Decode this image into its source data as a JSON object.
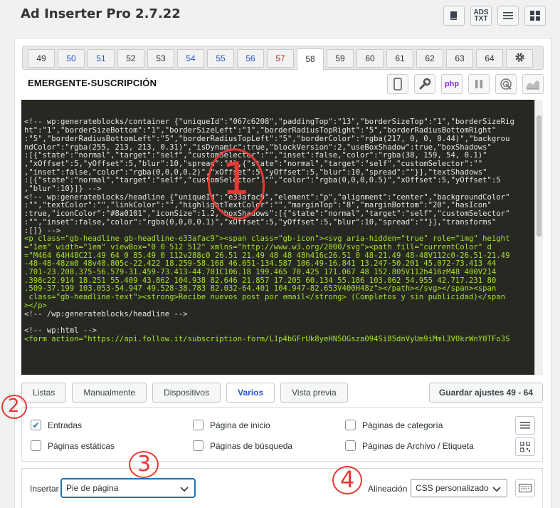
{
  "app": {
    "title": "Ad Inserter Pro 2.7.22",
    "top_icons": [
      "book-icon",
      "ads-txt-icon",
      "list-icon",
      "grid-icon"
    ],
    "ads_txt_line1": "ADS",
    "ads_txt_line2": "TXT"
  },
  "tabs": {
    "items": [
      {
        "label": "49",
        "style": "normal"
      },
      {
        "label": "50",
        "style": "blue"
      },
      {
        "label": "51",
        "style": "blue"
      },
      {
        "label": "52",
        "style": "normal"
      },
      {
        "label": "53",
        "style": "normal"
      },
      {
        "label": "54",
        "style": "blue"
      },
      {
        "label": "55",
        "style": "blue"
      },
      {
        "label": "56",
        "style": "blue"
      },
      {
        "label": "57",
        "style": "red"
      },
      {
        "label": "58",
        "style": "active"
      },
      {
        "label": "59",
        "style": "normal"
      },
      {
        "label": "60",
        "style": "normal"
      },
      {
        "label": "61",
        "style": "normal"
      },
      {
        "label": "62",
        "style": "normal"
      },
      {
        "label": "63",
        "style": "normal"
      },
      {
        "label": "64",
        "style": "normal"
      }
    ],
    "settings_icon": "gear-icon"
  },
  "block": {
    "name": "EMERGENTE-SUSCRIPCIÓN",
    "tool_icons": [
      "device-icon",
      "wrench-icon",
      "php-icon",
      "pause-icon",
      "target-icon",
      "chart-icon"
    ],
    "php_label": "php"
  },
  "code": {
    "lines": [
      "<!-- wp:generateblocks/container {\"uniqueId\":\"067c6208\",\"paddingTop\":\"13\",\"borderSizeTop\":\"1\",\"borderSizeRig",
      "ht\":\"1\",\"borderSizeBottom\":\"1\",\"borderSizeLeft\":\"1\",\"borderRadiusTopRight\":\"5\",\"borderRadiusBottomRight\"",
      ":\"5\",\"borderRadiusBottomLeft\":\"5\",\"borderRadiusTopLeft\":\"5\",\"borderColor\":\"rgba(217, 0, 0, 0.44)\",\"backgrou",
      "ndColor\":\"rgba(255, 213, 213, 0.31)\",\"isDynamic\":true,\"blockVersion\":2,\"useBoxShadow\":true,\"boxShadows\"",
      ":[{\"state\":\"normal\",\"target\":\"self\",\"customSelector\":\"\",\"inset\":false,\"color\":\"rgba(38, 159, 54, 0.1)\"",
      ",\"xOffset\":5,\"yOffset\":5,\"blur\":10,\"spread\":\"\"},{\"state\":\"normal\",\"target\":\"self\",\"customSelector\":\"\"",
      ",\"inset\":false,\"color\":\"rgba(0,0,0,0.2)\",\"xOffset\":5,\"yOffset\":5,\"blur\":10,\"spread\":\"\"}],\"textShadows\"",
      ":[{\"state\":\"normal\",\"target\":\"self\",\"customSelector\":\"\",\"color\":\"rgba(0,0,0,0.5)\",\"xOffset\":5,\"yOffset\":5",
      ",\"blur\":10}]} -->",
      "<!-- wp:generateblocks/headline {\"uniqueId\":\"e33afac9\",\"element\":\"p\",\"alignment\":\"center\",\"backgroundColor\"",
      ":\"\",\"textColor\":\"\",\"linkColor\":\"\",\"highlightTextColor\":\"\",\"marginTop\":\"8\",\"marginBottom\":\"20\",\"hasIcon\"",
      ":true,\"iconColor\":\"#8a0101\",\"iconSize\":1.2,\"boxShadows\":[{\"state\":\"normal\",\"target\":\"self\",\"customSelector\"",
      ":\"\",\"inset\":false,\"color\":\"rgba(0,0,0,0.1)\",\"xOffset\":5,\"yOffset\":5,\"blur\":10,\"spread\":\"\"}],\"transforms\"",
      ":[]} -->",
      "<p class=\"gb-headline gb-headline-e33afac9\"><span class=\"gb-icon\"><svg aria-hidden=\"true\" role=\"img\" height",
      "=\"1em\" width=\"1em\" viewBox=\"0 0 512 512\" xmlns=\"http://www.w3.org/2000/svg\"><path fill=\"currentColor\" d",
      "=\"M464 64H48C21.49 64 0 85.49 0 112v288c0 26.51 21.49 48 48 48h416c26.51 0 48-21.49 48-48V112c0-26.51-21.49",
      "-48-48-48zm0 48v40.805c-22.422 18.259-58.168 46.651-134.587 106.49-16.841 13.247-50.201 45.072-73.413 44",
      ".701-23.208.375-56.579-31.459-73.413-44.701C106.18 199.465 70.425 171.067 48 152.805V112h416zM48 400V214",
      ".398c22.914 18.251 55.409 43.862 104.938 82.646 21.857 17.205 60.134 55.186 103.062 54.955 42.717.231 80",
      ".509-37.199 103.053-54.947 49.528-38.783 82.032-64.401 104.947-82.653V400H48z\"></path></svg></span><span",
      " class=\"gb-headline-text\"><strong>Recibe nuevos post por email</strong> (Completos y sin publicidad)</span",
      "></p>",
      "<!-- /wp:generateblocks/headline -->",
      "",
      "<!-- wp:html -->",
      "<form action=\"https://api.follow.it/subscription-form/L1p4bGFrUk8yeHN5OGsza094Si85dnVyUm9iMml3V0krWnY0TFo3S"
    ]
  },
  "buttons": {
    "listas": "Listas",
    "manualmente": "Manualmente",
    "dispositivos": "Dispositivos",
    "varios": "Varios",
    "vista_previa": "Vista previa",
    "guardar": "Guardar ajustes 49 - 64"
  },
  "options": {
    "entradas": {
      "label": "Entradas",
      "checked": true
    },
    "paginas_estaticas": {
      "label": "Páginas estáticas",
      "checked": false
    },
    "pagina_inicio": {
      "label": "Página de inicio",
      "checked": false
    },
    "paginas_busqueda": {
      "label": "Páginas de búsqueda",
      "checked": false
    },
    "paginas_categoria": {
      "label": "Páginas de categoría",
      "checked": false
    },
    "paginas_archivo": {
      "label": "Páginas de Archivo / Etiqueta",
      "checked": false
    }
  },
  "insert": {
    "label": "Insertar",
    "value": "Pie de página",
    "alignment_label": "Alineación",
    "alignment_value": "CSS personalizado"
  },
  "annotations": {
    "one": "1",
    "two": "2",
    "three": "3",
    "four": "4",
    "color": "#e53935"
  }
}
